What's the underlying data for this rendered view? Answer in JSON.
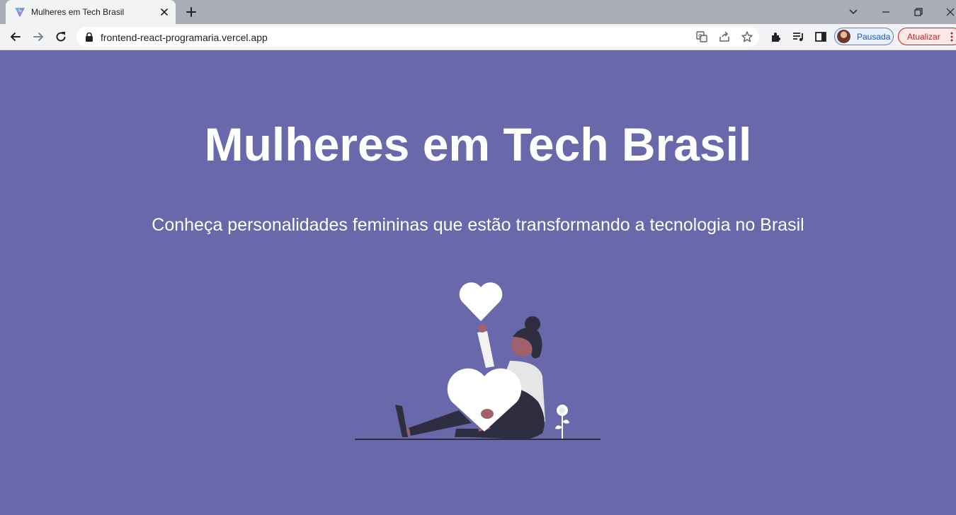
{
  "browser": {
    "tab": {
      "title": "Mulheres em Tech Brasil",
      "favicon": "vite-logo-icon"
    },
    "address_bar": {
      "url": "frontend-react-programaria.vercel.app"
    },
    "profile": {
      "label": "Pausada"
    },
    "update_button": {
      "label": "Atualizar"
    },
    "colors": {
      "tabstrip": "#a9adb5",
      "toolbar": "#f1f3f4"
    }
  },
  "page": {
    "title": "Mulheres em Tech Brasil",
    "subtitle": "Conheça personalidades femininas que estão transformando a tecnologia no Brasil",
    "illustration": "woman-with-hearts-illustration",
    "colors": {
      "background": "#6868aa",
      "text": "#ffffff"
    }
  }
}
